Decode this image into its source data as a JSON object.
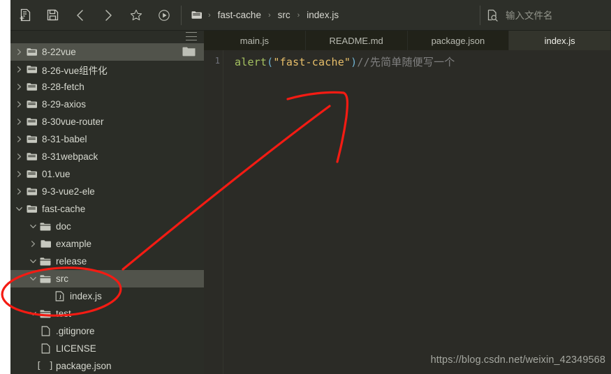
{
  "window": {
    "title": "index.js"
  },
  "toolbar": {
    "buttons": [
      {
        "name": "new-file-icon",
        "label": "New File"
      },
      {
        "name": "save-icon",
        "label": "Save"
      },
      {
        "name": "back-arrow-icon",
        "label": "Back"
      },
      {
        "name": "forward-arrow-icon",
        "label": "Forward"
      },
      {
        "name": "star-icon",
        "label": "Favorite"
      },
      {
        "name": "run-icon",
        "label": "Run"
      }
    ],
    "breadcrumb": {
      "root_icon": "folder-icon",
      "separator": "›",
      "items": [
        "fast-cache",
        "src",
        "index.js"
      ]
    },
    "search": {
      "icon": "file-search-icon",
      "placeholder": "输入文件名",
      "value": ""
    }
  },
  "sidebar": {
    "menu_icon": "hamburger-menu-icon",
    "selected_index": 0,
    "items": [
      {
        "label": "8-22vue",
        "indent": 0,
        "twisty": "right",
        "icon": "folder-icon",
        "selected": true,
        "right_icon": "folder-solid-icon"
      },
      {
        "label": "8-26-vue组件化",
        "indent": 0,
        "twisty": "right",
        "icon": "folder-icon",
        "selected": false,
        "right_icon": ""
      },
      {
        "label": "8-28-fetch",
        "indent": 0,
        "twisty": "right",
        "icon": "folder-icon",
        "selected": false,
        "right_icon": ""
      },
      {
        "label": "8-29-axios",
        "indent": 0,
        "twisty": "right",
        "icon": "folder-icon",
        "selected": false,
        "right_icon": ""
      },
      {
        "label": "8-30vue-router",
        "indent": 0,
        "twisty": "right",
        "icon": "folder-icon",
        "selected": false,
        "right_icon": ""
      },
      {
        "label": "8-31-babel",
        "indent": 0,
        "twisty": "right",
        "icon": "folder-icon",
        "selected": false,
        "right_icon": ""
      },
      {
        "label": "8-31webpack",
        "indent": 0,
        "twisty": "right",
        "icon": "folder-icon",
        "selected": false,
        "right_icon": ""
      },
      {
        "label": "01.vue",
        "indent": 0,
        "twisty": "right",
        "icon": "folder-icon",
        "selected": false,
        "right_icon": ""
      },
      {
        "label": "9-3-vue2-ele",
        "indent": 0,
        "twisty": "right",
        "icon": "folder-icon",
        "selected": false,
        "right_icon": ""
      },
      {
        "label": "fast-cache",
        "indent": 0,
        "twisty": "down",
        "icon": "folder-icon",
        "selected": false,
        "right_icon": ""
      },
      {
        "label": "doc",
        "indent": 1,
        "twisty": "down",
        "icon": "folder-open-icon",
        "selected": false,
        "right_icon": ""
      },
      {
        "label": "example",
        "indent": 1,
        "twisty": "right",
        "icon": "folder-solid-icon",
        "selected": false,
        "right_icon": ""
      },
      {
        "label": "release",
        "indent": 1,
        "twisty": "down",
        "icon": "folder-open-icon",
        "selected": false,
        "right_icon": ""
      },
      {
        "label": "src",
        "indent": 1,
        "twisty": "down",
        "icon": "folder-open-icon",
        "selected": true,
        "right_icon": ""
      },
      {
        "label": "index.js",
        "indent": 2,
        "twisty": "none",
        "icon": "js-file-icon",
        "selected": false,
        "right_icon": ""
      },
      {
        "label": "test",
        "indent": 1,
        "twisty": "down",
        "icon": "folder-open-icon",
        "selected": false,
        "right_icon": ""
      },
      {
        "label": ".gitignore",
        "indent": 1,
        "twisty": "none",
        "icon": "file-icon",
        "selected": false,
        "right_icon": ""
      },
      {
        "label": "LICENSE",
        "indent": 1,
        "twisty": "none",
        "icon": "file-icon",
        "selected": false,
        "right_icon": ""
      },
      {
        "label": "package.json",
        "indent": 1,
        "twisty": "none",
        "icon": "json-file-icon",
        "selected": false,
        "right_icon": ""
      }
    ]
  },
  "editor": {
    "tabs": [
      {
        "label": "main.js",
        "active": false
      },
      {
        "label": "README.md",
        "active": false
      },
      {
        "label": "package.json",
        "active": false
      },
      {
        "label": "index.js",
        "active": true
      }
    ],
    "line_number": "1",
    "code": {
      "fn": "alert",
      "open_paren": "(",
      "string": "\"fast-cache\"",
      "close_paren": ")",
      "comment": "//先简单随便写一个"
    }
  },
  "watermark": {
    "text": "https://blog.csdn.net/weixin_42349568"
  },
  "annotations": {
    "color": "#f41b13",
    "arrow_label": "red-arrow-to-index-js",
    "ellipse_label": "red-ellipse-around-src-index"
  },
  "colors": {
    "editor_bg": "#2b2b26",
    "sidebar_bg": "#2b2d27",
    "toolbar_bg": "#2d2f29",
    "tabbar_bg": "#212219",
    "tab_active_bg": "#33342c",
    "row_selected_bg": "#51534b",
    "text": "#d6d8cf",
    "annotation_red": "#f41b13"
  }
}
